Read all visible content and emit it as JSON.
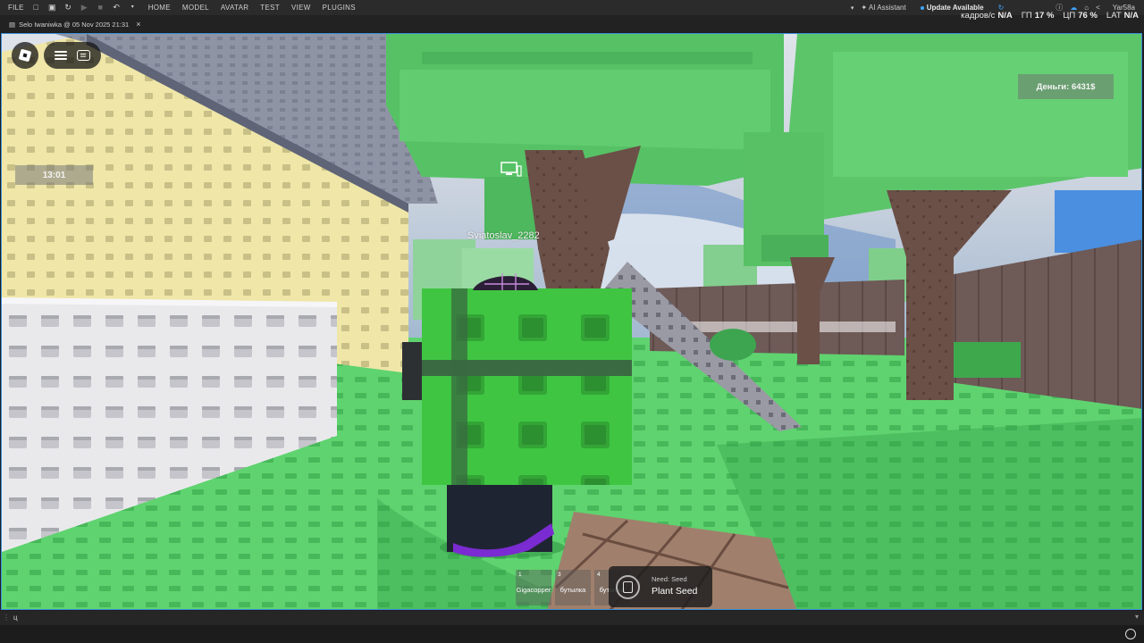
{
  "topbar": {
    "file": "FILE",
    "nav": [
      "HOME",
      "MODEL",
      "AVATAR",
      "TEST",
      "VIEW",
      "PLUGINS"
    ],
    "ai_assistant": "AI Assistant",
    "update": "Update Available",
    "user": "Yar58a"
  },
  "tab": {
    "title": "Selo Iwaniwka @ 05 Nov 2025 21:31"
  },
  "stats": [
    {
      "key": "кадров/с",
      "value": "N/A"
    },
    {
      "key": "ГП",
      "value": "17 %"
    },
    {
      "key": "ЦП",
      "value": "76 %"
    },
    {
      "key": "LAT",
      "value": "N/A"
    }
  ],
  "hud": {
    "time": "13:01",
    "money": "Деньги: 6431$",
    "player_name": "Sviatoslav_2282"
  },
  "hotbar": [
    {
      "num": "1",
      "label": "Gigacopper"
    },
    {
      "num": "3",
      "label": "бутылка"
    },
    {
      "num": "4",
      "label": "бутылка"
    }
  ],
  "prompt": {
    "object": "Need: Seed",
    "action": "Plant Seed"
  },
  "command_bar": {
    "text": "ц"
  },
  "colors": {
    "grass": "#5fd36f",
    "grass_dark": "#3fae55",
    "foliage": "#5cc56a",
    "trunk": "#6b5048",
    "fence": "#6e5a57",
    "wall_yellow": "#efe6a8",
    "wall_white": "#e9e9ec",
    "roof": "#8b90a0",
    "sky": "#aeb9c9",
    "viewport_border": "#3a8fd9",
    "studio_bar": "#2b2b2b"
  }
}
